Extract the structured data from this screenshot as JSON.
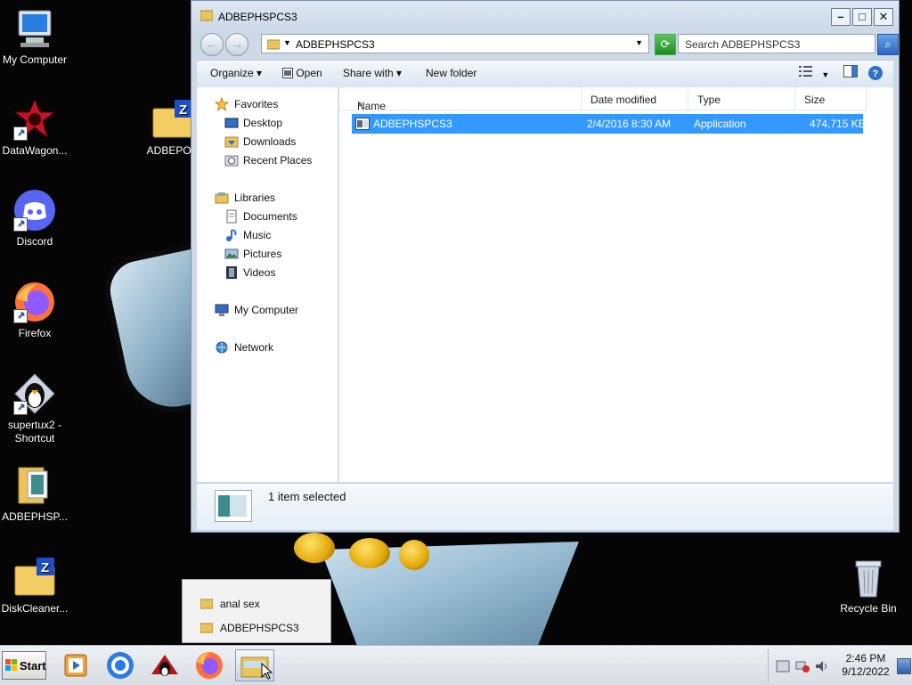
{
  "desktop": {
    "icons": [
      {
        "label": "My Computer",
        "icon": "computer-icon"
      },
      {
        "label": "DataWagon...",
        "icon": "datawagon-icon"
      },
      {
        "label": "Discord",
        "icon": "discord-icon"
      },
      {
        "label": "Firefox",
        "icon": "firefox-icon"
      },
      {
        "label": "supertux2 - Shortcut",
        "icon": "supertux-icon"
      },
      {
        "label": "ADBEPHSP...",
        "icon": "folder-icon"
      },
      {
        "label": "DiskCleaner...",
        "icon": "zip-folder-icon"
      },
      {
        "label": "ADBEPOH",
        "icon": "zip-folder-icon"
      },
      {
        "label": "Recycle Bin",
        "icon": "recycle-bin-icon"
      }
    ]
  },
  "explorer": {
    "title": "ADBEPHSPCS3",
    "address": "ADBEPHSPCS3",
    "search_placeholder": "Search ADBEPHSPCS3",
    "toolbar": {
      "organize": "Organize",
      "open": "Open",
      "share_with": "Share with",
      "new_folder": "New folder"
    },
    "nav": {
      "favorites": "Favorites",
      "desktop": "Desktop",
      "downloads": "Downloads",
      "recent_places": "Recent Places",
      "libraries": "Libraries",
      "documents": "Documents",
      "music": "Music",
      "pictures": "Pictures",
      "videos": "Videos",
      "my_computer": "My Computer",
      "network": "Network"
    },
    "columns": {
      "name": "Name",
      "date_modified": "Date modified",
      "type": "Type",
      "size": "Size"
    },
    "files": [
      {
        "name": "ADBEPHSPCS3",
        "date": "2/4/2016 8:30 AM",
        "type": "Application",
        "size": "474,715 KB"
      }
    ],
    "status": "1 item selected"
  },
  "jumplist": {
    "items": [
      "anal sex",
      "ADBEPHSPCS3"
    ]
  },
  "taskbar": {
    "start_label": "Start",
    "apps": [
      "media-player-icon",
      "chrome-icon",
      "supertux-icon",
      "firefox-icon",
      "explorer-icon"
    ],
    "clock": {
      "time": "2:46 PM",
      "date": "9/12/2022"
    }
  },
  "colors": {
    "selection": "#3399ff",
    "window_frame": "#cfd9e6",
    "desktop_bg": "#050505"
  }
}
